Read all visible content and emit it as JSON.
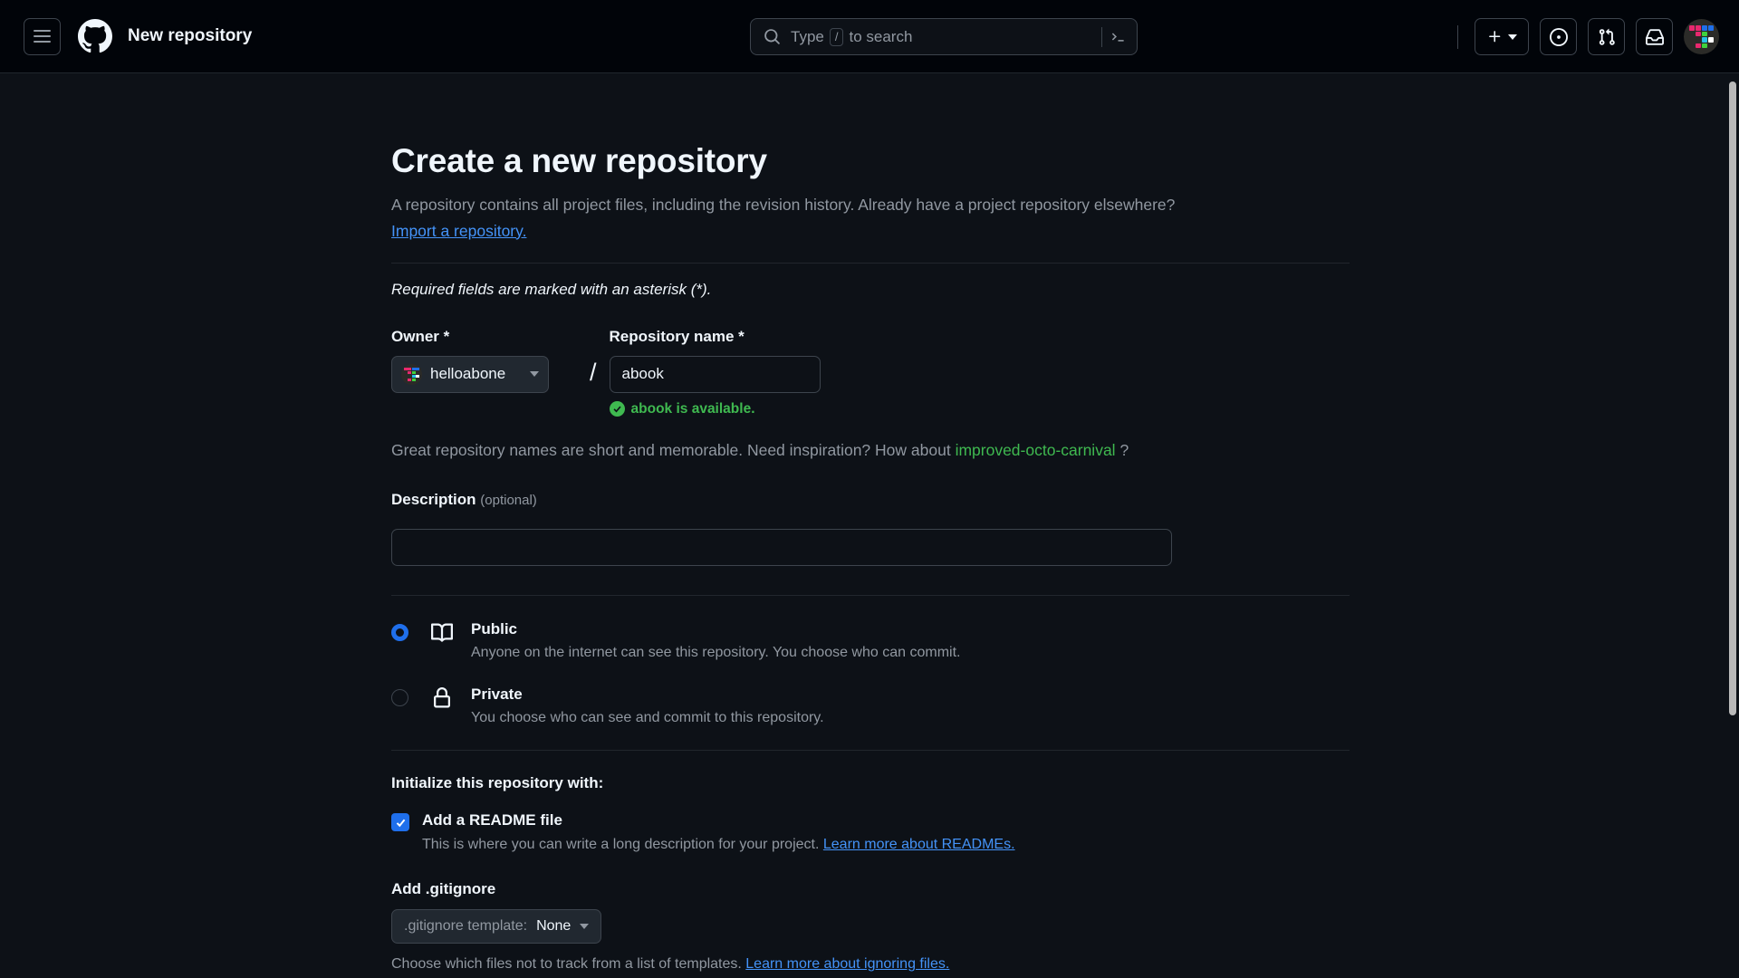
{
  "header": {
    "menu_icon": "hamburger-icon",
    "logo_icon": "github-logo-icon",
    "title": "New repository",
    "search": {
      "icon": "search-icon",
      "placeholder_prefix": "Type",
      "key_hint": "/",
      "placeholder_suffix": "to search",
      "command_icon": "terminal-icon"
    },
    "create_button_label": "+",
    "issues_icon": "issues-icon",
    "pull_requests_icon": "pull-request-icon",
    "inbox_icon": "inbox-icon",
    "avatar_icon": "user-avatar"
  },
  "main": {
    "heading": "Create a new repository",
    "intro": "A repository contains all project files, including the revision history. Already have a project repository elsewhere?",
    "import_link": "Import a repository.",
    "required_note": "Required fields are marked with an asterisk (*).",
    "owner": {
      "label": "Owner *",
      "value": "helloabone"
    },
    "repo_name": {
      "label": "Repository name *",
      "value": "abook",
      "separator": "/",
      "availability": "abook is available."
    },
    "suggestion": {
      "prefix": "Great repository names are short and memorable. Need inspiration? How about",
      "name": "improved-octo-carnival",
      "suffix": "?"
    },
    "description": {
      "label": "Description",
      "optional": "(optional)",
      "value": "",
      "placeholder": ""
    },
    "visibility": [
      {
        "id": "public",
        "icon": "repo-book-icon",
        "title": "Public",
        "description": "Anyone on the internet can see this repository. You choose who can commit.",
        "selected": true
      },
      {
        "id": "private",
        "icon": "lock-icon",
        "title": "Private",
        "description": "You choose who can see and commit to this repository.",
        "selected": false
      }
    ],
    "initialize": {
      "heading": "Initialize this repository with:",
      "readme": {
        "title": "Add a README file",
        "checked": true,
        "description": "This is where you can write a long description for your project.",
        "link": "Learn more about READMEs."
      }
    },
    "gitignore": {
      "heading": "Add .gitignore",
      "select_label": ".gitignore template:",
      "select_value": "None",
      "description": "Choose which files not to track from a list of templates.",
      "link": "Learn more about ignoring files."
    }
  },
  "colors": {
    "page_bg": "#0d1117",
    "header_bg": "#010409",
    "accent_blue": "#1f6feb",
    "link_blue": "#4493f8",
    "success_green": "#3fb950",
    "muted_text": "#9198a1",
    "primary_text": "#f0f6fc",
    "border": "#3d444d"
  }
}
